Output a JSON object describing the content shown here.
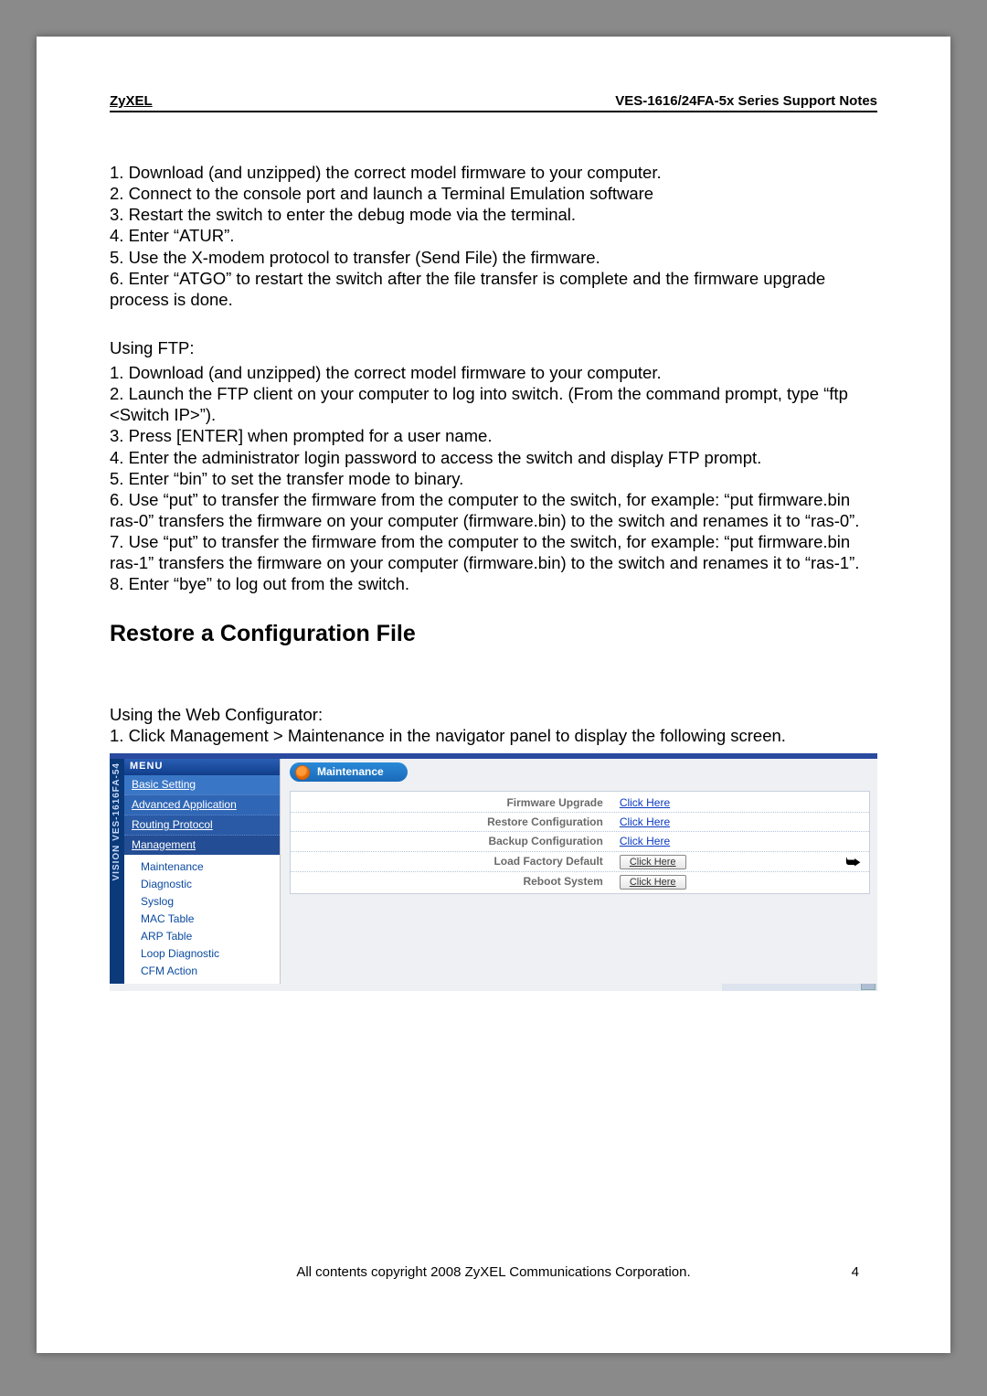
{
  "header": {
    "brand": "ZyXEL",
    "title": "VES-1616/24FA-5x Series Support Notes"
  },
  "listA": [
    "1. Download (and unzipped) the correct model firmware to your computer.",
    "2. Connect to the console port and launch a Terminal Emulation software",
    "3. Restart the switch to enter the debug mode via the terminal.",
    "4. Enter “ATUR”.",
    "5. Use the X-modem protocol to transfer (Send File) the firmware.",
    "6. Enter “ATGO” to restart the switch after the file transfer is complete and the firmware upgrade process is done."
  ],
  "ftpHeading": "Using FTP:",
  "listB": [
    "1. Download (and unzipped) the correct model firmware to your computer.",
    "2. Launch the FTP client on your computer to log into switch. (From the command prompt, type “ftp <Switch IP>”).",
    "3. Press [ENTER] when prompted for a user name.",
    "4. Enter the administrator login password to access the switch and display FTP prompt.",
    "5. Enter “bin” to set the transfer mode to binary.",
    "6. Use “put” to transfer the firmware from the computer to the switch, for example: “put firmware.bin ras-0” transfers the firmware on your computer (firmware.bin) to the switch and renames it to “ras-0”.",
    "7. Use “put” to transfer the firmware from the computer to the switch, for example: “put firmware.bin ras-1” transfers the firmware on your computer (firmware.bin) to the switch and renames it to “ras-1”.",
    "8. Enter “bye” to log out from the switch."
  ],
  "sectionTitle": "Restore a Configuration File",
  "webConfHeading": "Using the Web Configurator:",
  "webConfStep": "1. Click Management > Maintenance in the navigator panel to display the following screen.",
  "screenshot": {
    "sideLabel": "VISION  VES-1616FA-54",
    "menuLabel": "MENU",
    "nav": [
      "Basic Setting",
      "Advanced Application",
      "Routing Protocol",
      "Management"
    ],
    "navSub": [
      "Maintenance",
      "Diagnostic",
      "Syslog",
      "MAC Table",
      "ARP Table",
      "Loop Diagnostic",
      "CFM Action"
    ],
    "panelTitle": "Maintenance",
    "rows": [
      {
        "label": "Firmware Upgrade",
        "action": "Click Here",
        "type": "link"
      },
      {
        "label": "Restore Configuration",
        "action": "Click Here",
        "type": "link"
      },
      {
        "label": "Backup Configuration",
        "action": "Click Here",
        "type": "link"
      },
      {
        "label": "Load Factory Default",
        "action": "Click Here",
        "type": "button"
      },
      {
        "label": "Reboot System",
        "action": "Click Here",
        "type": "button"
      }
    ]
  },
  "footer": "All contents copyright 2008 ZyXEL Communications Corporation.",
  "pageNumber": "4"
}
